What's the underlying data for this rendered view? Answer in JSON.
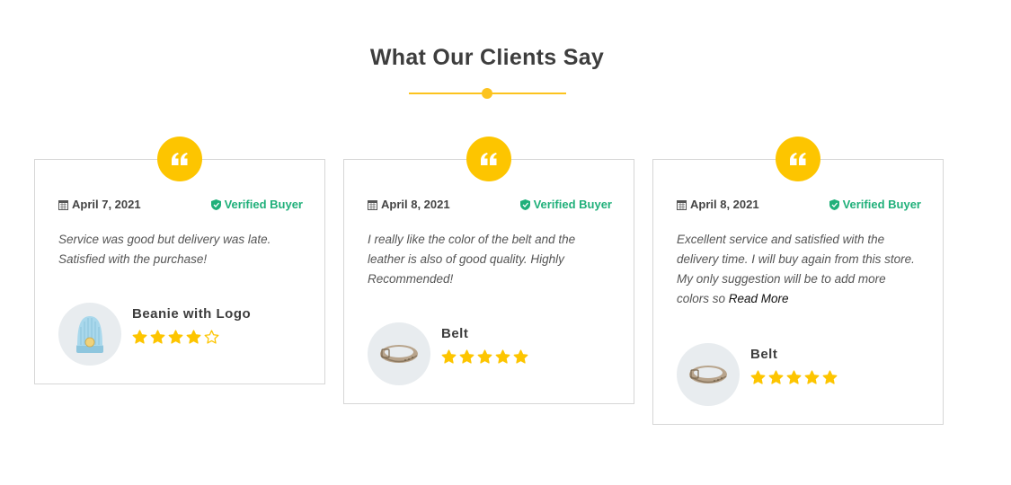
{
  "section": {
    "title": "What Our Clients Say"
  },
  "colors": {
    "accent": "#fdc500",
    "verified": "#20b07a",
    "border": "#d6d6d6"
  },
  "reviews": [
    {
      "date": "April 7, 2021",
      "verified_label": "Verified Buyer",
      "text": "Service was good but delivery was late. Satisfied with the purchase!",
      "read_more": "",
      "product": "Beanie with Logo",
      "product_image": "beanie-icon",
      "rating": 4
    },
    {
      "date": "April 8, 2021",
      "verified_label": "Verified Buyer",
      "text": "I really like the color of the belt and the leather is also of good quality. Highly Recommended!",
      "read_more": "",
      "product": "Belt",
      "product_image": "belt-icon",
      "rating": 5
    },
    {
      "date": "April 8, 2021",
      "verified_label": "Verified Buyer",
      "text": "Excellent service and satisfied with the delivery time. I will buy again from this store. My only suggestion will be to add more colors so ",
      "read_more": "Read More",
      "product": "Belt",
      "product_image": "belt-icon",
      "rating": 5
    }
  ]
}
